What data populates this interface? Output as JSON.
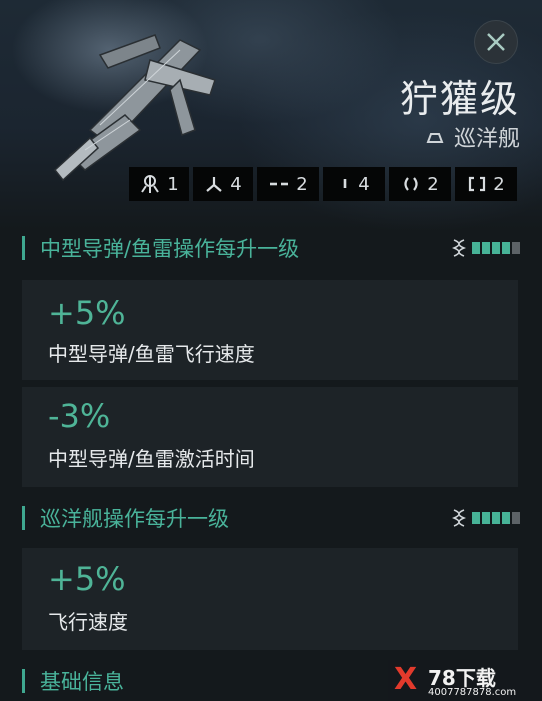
{
  "ship": {
    "name": "狞獾级",
    "class_label": "巡洋舰"
  },
  "slots": [
    {
      "icon": "high-slot-icon",
      "value": "1"
    },
    {
      "icon": "turret-icon",
      "value": "4"
    },
    {
      "icon": "mid-slot-icon",
      "value": "2"
    },
    {
      "icon": "low-slot-icon",
      "value": "4"
    },
    {
      "icon": "launcher-icon",
      "value": "2"
    },
    {
      "icon": "rig-slot-icon",
      "value": "2"
    }
  ],
  "sections": [
    {
      "title": "中型导弹/鱼雷操作每升一级",
      "skill_level": 4,
      "skill_max": 5,
      "bonuses": [
        {
          "value": "+5%",
          "description": "中型导弹/鱼雷飞行速度"
        },
        {
          "value": "-3%",
          "description": "中型导弹/鱼雷激活时间"
        }
      ]
    },
    {
      "title": "巡洋舰操作每升一级",
      "skill_level": 4,
      "skill_max": 5,
      "bonuses": [
        {
          "value": "+5%",
          "description": "飞行速度"
        }
      ]
    },
    {
      "title": "基础信息"
    }
  ],
  "watermark": {
    "brand": "X",
    "title": "78下载",
    "url": "4007787878.com"
  },
  "colors": {
    "accent": "#49b39a",
    "background": "#14191c",
    "card": "#1d2327"
  }
}
